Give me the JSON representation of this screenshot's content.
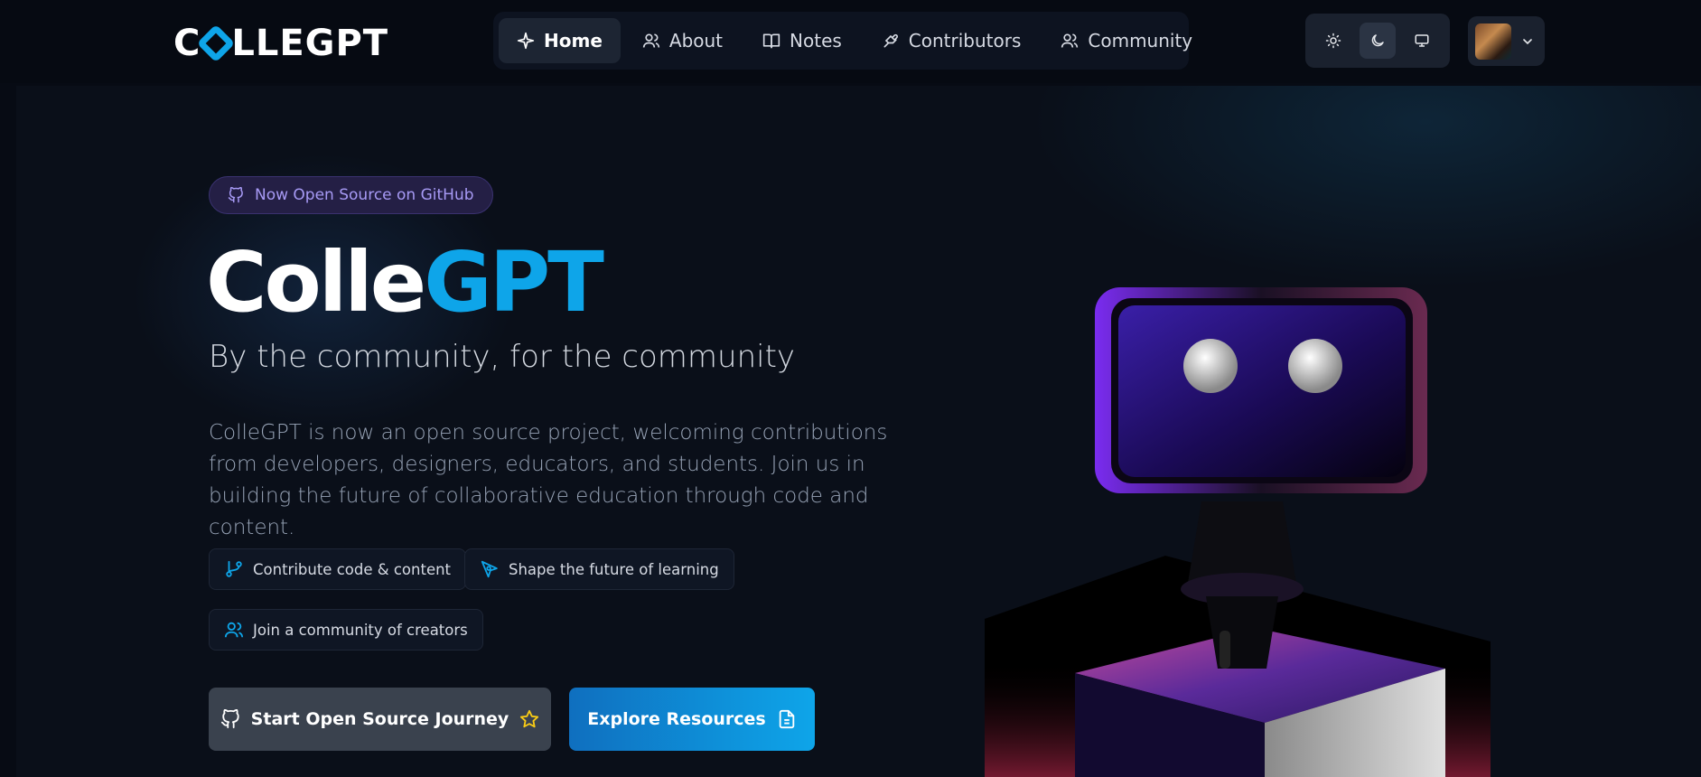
{
  "brand": {
    "logo_left": "C",
    "logo_right": "LLEGPT"
  },
  "nav": {
    "items": [
      {
        "label": "Home",
        "icon": "sparkle-icon",
        "active": true
      },
      {
        "label": "About",
        "icon": "users-icon",
        "active": false
      },
      {
        "label": "Notes",
        "icon": "book-open-icon",
        "active": false
      },
      {
        "label": "Contributors",
        "icon": "hand-heart-icon",
        "active": false
      },
      {
        "label": "Community",
        "icon": "users-icon",
        "active": false
      }
    ]
  },
  "theme": {
    "options": [
      "light",
      "dark",
      "system"
    ],
    "selected": "dark"
  },
  "hero": {
    "badge": "Now Open Source on GitHub",
    "title_main": "Colle",
    "title_accent": "GPT",
    "tagline": "By the community, for the community",
    "description": "CollеGPT is now an open source project, welcoming contributions from developers, designers, educators, and students. Join us in building the future of collaborative education through code and content.",
    "chips": [
      {
        "label": "Contribute code & content",
        "icon": "git-branch-icon"
      },
      {
        "label": "Shape the future of learning",
        "icon": "pen-tool-icon"
      },
      {
        "label": "Join a community of creators",
        "icon": "users-icon"
      }
    ],
    "primary_cta": "Start Open Source Journey",
    "secondary_cta": "Explore Resources"
  },
  "colors": {
    "accent": "#0ea5e9",
    "background": "#070b14",
    "badge_text": "#a79af5",
    "star": "#facc15"
  }
}
